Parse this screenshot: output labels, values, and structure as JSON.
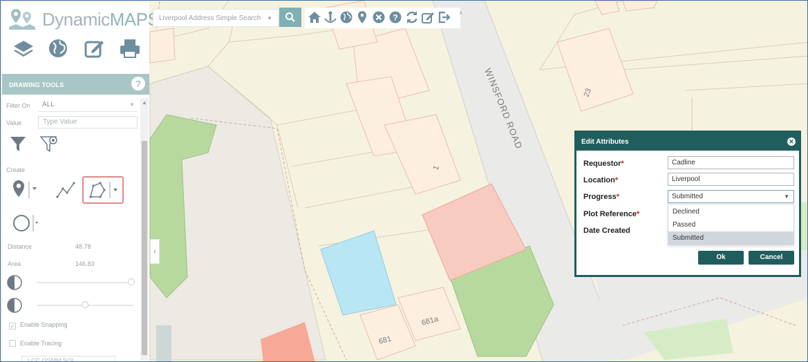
{
  "app": {
    "logo_part1": "Dynamic",
    "logo_part2": "MAPS"
  },
  "search": {
    "placeholder": "Liverpool Address Simple Search"
  },
  "nav_icons": [
    "home-icon",
    "anchor-person-icon",
    "globe-icon",
    "location-pin-icon",
    "clear-circle-icon",
    "help-circle-icon",
    "refresh-icon",
    "edit-icon",
    "logout-icon"
  ],
  "tools_row": [
    "layers-icon",
    "globe-icon",
    "edit-icon",
    "print-icon"
  ],
  "drawing_tools": {
    "header": "DRAWING TOOLS",
    "help_glyph": "?",
    "filter_label": "Filter On",
    "filter_value": "ALL",
    "value_label": "Value",
    "value_placeholder": "Type Value",
    "create_label": "Create",
    "distance_label": "Distance",
    "distance_value": "48.78",
    "area_label": "Area",
    "area_value": "146.83",
    "snapping_label": "Enable Snapping",
    "snapping_checked": true,
    "tracing_label": "Enable Tracing",
    "tracing_checked": false,
    "layer_value": "LCC OSMM SOL",
    "slider1_level": 0.98,
    "slider2_level": 0.5
  },
  "map": {
    "road_name": "WINSFORD ROAD",
    "numbers": [
      "23",
      "1",
      "681",
      "681a"
    ],
    "colors": {
      "background": "#f6f2e0",
      "road": "#eaeae8",
      "building": "#fdefdf",
      "green": "#b8d99e",
      "red": "#f7a896",
      "blue": "#b8e6f5"
    }
  },
  "dialog": {
    "title": "Edit Attributes",
    "requestor_label": "Requestor",
    "requestor_value": "Cadline",
    "location_label": "Location",
    "location_value": "Liverpool",
    "progress_label": "Progress",
    "progress_value": "Submitted",
    "plot_ref_label": "Plot Reference",
    "date_created_label": "Date Created",
    "required_mark": "*",
    "options": [
      "Declined",
      "Passed",
      "Submitted"
    ],
    "selected_option": "Submitted",
    "ok_label": "Ok",
    "cancel_label": "Cancel",
    "accent": "#1f5e5c"
  }
}
